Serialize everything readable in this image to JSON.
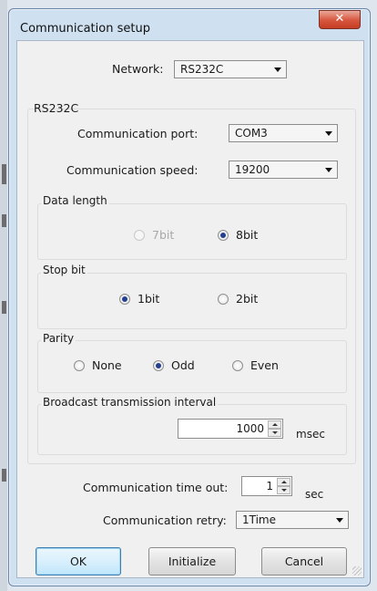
{
  "window": {
    "title": "Communication setup",
    "close_glyph": "✕"
  },
  "network": {
    "label": "Network:",
    "value": "RS232C"
  },
  "rs232c": {
    "group_label": "RS232C",
    "port": {
      "label": "Communication port:",
      "value": "COM3"
    },
    "speed": {
      "label": "Communication speed:",
      "value": "19200"
    },
    "data_length": {
      "label": "Data length",
      "opt1": "7bit",
      "opt2": "8bit",
      "selected": "8bit"
    },
    "stop_bit": {
      "label": "Stop bit",
      "opt1": "1bit",
      "opt2": "2bit",
      "selected": "1bit"
    },
    "parity": {
      "label": "Parity",
      "opt1": "None",
      "opt2": "Odd",
      "opt3": "Even",
      "selected": "Odd"
    },
    "broadcast": {
      "label": "Broadcast transmission interval",
      "value": "1000",
      "unit": "msec"
    }
  },
  "timeout": {
    "label": "Communication time out:",
    "value": "1",
    "unit": "sec"
  },
  "retry": {
    "label": "Communication retry:",
    "value": "1Time"
  },
  "buttons": {
    "ok": "OK",
    "initialize": "Initialize",
    "cancel": "Cancel"
  }
}
